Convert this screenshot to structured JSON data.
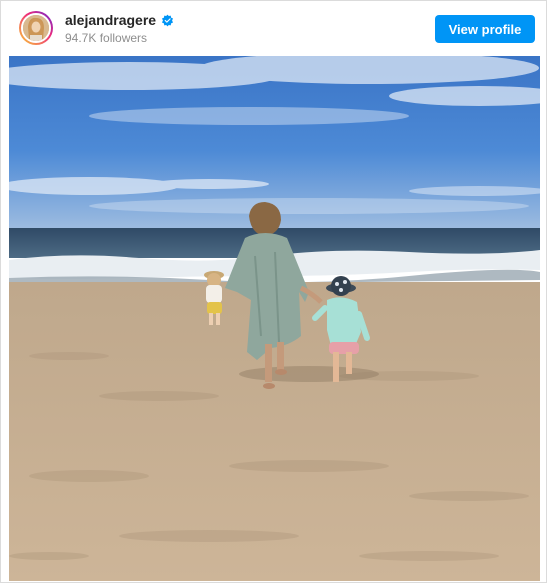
{
  "profile": {
    "username": "alejandragere",
    "followers": "94.7K followers",
    "verified": true
  },
  "header": {
    "view_profile_label": "View profile"
  },
  "colors": {
    "accent": "#0095f6",
    "verified_badge": "#0095f6",
    "sky_top": "#3f7ccc",
    "sea": "#34516c",
    "sand": "#cbb295"
  },
  "icons": {
    "verified": "verified-badge-icon"
  }
}
